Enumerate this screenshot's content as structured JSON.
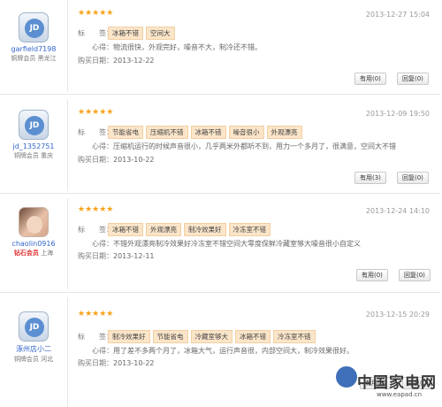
{
  "stars_glyph": "★★★★★",
  "labels": {
    "tags": "标　　签：",
    "experience": "心得：",
    "purchase_date": "购买日期："
  },
  "reviews": [
    {
      "user": {
        "name": "garfield7198",
        "level": "铜牌会员",
        "location": "黑龙江",
        "avatar": "jd-icon"
      },
      "date": "2013-12-27 15:04",
      "tags": [
        "冰箱不错",
        "空间大"
      ],
      "experience": "物流很快，外观完好，噪音不大，制冷还不错。",
      "purchase_date": "2013-12-22",
      "useful": "有用(0)",
      "reply": "回复(0)"
    },
    {
      "user": {
        "name": "jd_1352751",
        "level": "铜牌会员",
        "location": "重庆",
        "avatar": "jd-icon"
      },
      "date": "2013-12-09 19:50",
      "tags": [
        "节能省电",
        "压缩机不错",
        "冰箱不错",
        "噪音很小",
        "外观漂亮"
      ],
      "experience": "压缩机运行的时候声音很小，几乎两米外都听不到，用力一个多月了，很满意，空间大不错",
      "purchase_date": "2013-10-22",
      "useful": "有用(3)",
      "reply": "回复(0)"
    },
    {
      "user": {
        "name": "chaolin0916",
        "level": "钻石会员",
        "location": "上海",
        "avatar": "user-photo"
      },
      "date": "2013-12-24 14:10",
      "tags": [
        "冰箱不错",
        "外观漂亮",
        "制冷效果好",
        "冷冻室不错"
      ],
      "experience": "不错外观漂亮制冷效果好冷冻室不错空间大零度保鲜冷藏室够大噪音很小自定义",
      "purchase_date": "2013-12-11",
      "useful": "有用(0)",
      "reply": "回复(0)"
    },
    {
      "user": {
        "name": "涿州店小二",
        "level": "铜牌会员",
        "location": "河北",
        "avatar": "jd-icon"
      },
      "date": "2013-12-15 20:29",
      "tags": [
        "制冷效果好",
        "节能省电",
        "冷藏室够大",
        "冰箱不错",
        "冷冻室不错"
      ],
      "experience": "用了差不多两个月了，冰箱大气，运行声音很，内部空间大，制冷效果很好。",
      "purchase_date": "2013-10-22",
      "useful": "有用(0)",
      "reply": "回复(0)"
    }
  ],
  "watermark": {
    "text": "中国家电网",
    "url": "www.eapad.cn"
  },
  "colors": {
    "star": "#f7a21a",
    "tag_bg": "#fbe5c9",
    "username": "#3366cc",
    "diamond": "#e03030"
  }
}
